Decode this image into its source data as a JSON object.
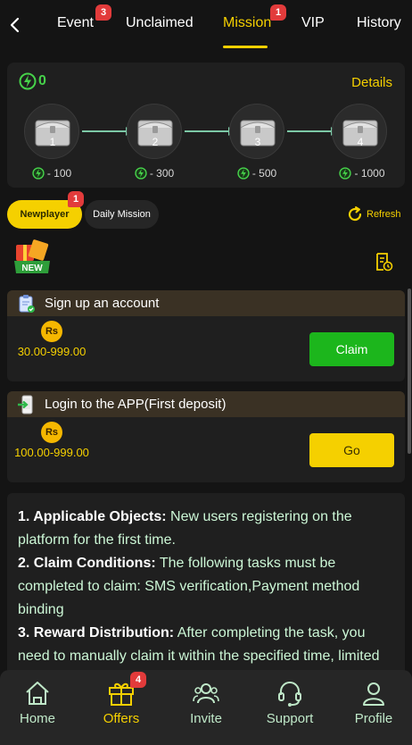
{
  "tabs": [
    {
      "label": "Event",
      "badge": "3"
    },
    {
      "label": "Unclaimed",
      "badge": ""
    },
    {
      "label": "Mission",
      "badge": "1",
      "active": true
    },
    {
      "label": "VIP",
      "badge": ""
    },
    {
      "label": "History",
      "badge": ""
    }
  ],
  "energy": {
    "count": "0"
  },
  "details_label": "Details",
  "chests": [
    {
      "number": "1",
      "cost": "- 100"
    },
    {
      "number": "2",
      "cost": "- 300"
    },
    {
      "number": "3",
      "cost": "- 500"
    },
    {
      "number": "4",
      "cost": "- 1000"
    }
  ],
  "filters": {
    "newplayer": {
      "label": "Newplayer",
      "badge": "1"
    },
    "daily": {
      "label": "Daily Mission"
    }
  },
  "refresh_label": "Refresh",
  "tasks": [
    {
      "title": "Sign up an account",
      "currency": "Rs",
      "amount": "30.00-999.00",
      "action": "Claim"
    },
    {
      "title": "Login to the APP(First deposit)",
      "currency": "Rs",
      "amount": "100.00-999.00",
      "action": "Go"
    }
  ],
  "rules": [
    {
      "heading": "1. Applicable Objects:",
      "text": " New users registering on the platform for the first time."
    },
    {
      "heading": "2. Claim Conditions:",
      "text": " The following tasks must be completed to claim: SMS verification,Payment method binding"
    },
    {
      "heading": "3. Reward Distribution:",
      "text": " After completing the task, you need to manually claim it within the specified time, limited"
    }
  ],
  "nav": [
    {
      "label": "Home",
      "icon": "home-icon"
    },
    {
      "label": "Offers",
      "icon": "gift-icon",
      "badge": "4",
      "active": true
    },
    {
      "label": "Invite",
      "icon": "invite-icon"
    },
    {
      "label": "Support",
      "icon": "headset-icon"
    },
    {
      "label": "Profile",
      "icon": "profile-icon"
    }
  ],
  "colors": {
    "accent": "#f5d000",
    "green": "#1cb61c",
    "background": "#141414",
    "card": "#1f1f1f",
    "badge": "#e23b3b"
  }
}
